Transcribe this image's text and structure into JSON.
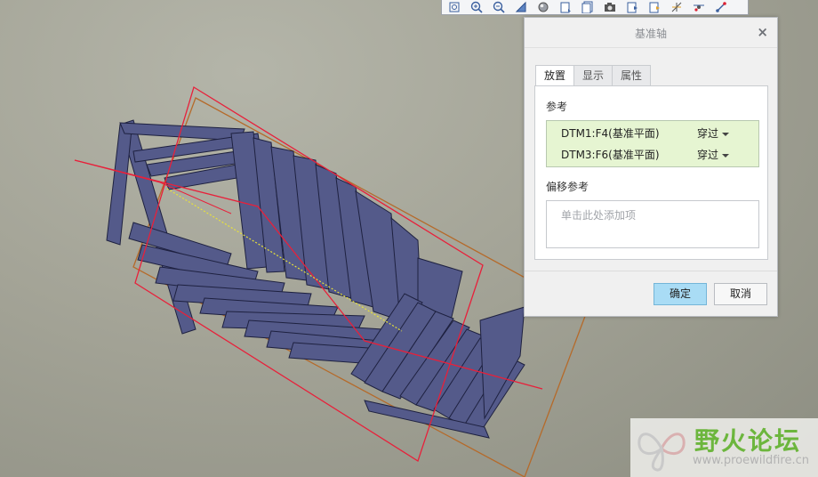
{
  "toolbar": {
    "icons": [
      "refit-icon",
      "zoom-in-icon",
      "zoom-out-icon",
      "repaint-icon",
      "display-style-icon",
      "saved-orientations-icon",
      "named-views-icon",
      "camera-icon",
      "datum-display-icon",
      "annotation-display-icon",
      "spin-center-icon",
      "datum-point-icon",
      "datum-csys-icon"
    ]
  },
  "dialog": {
    "title": "基准轴",
    "close_glyph": "×",
    "tabs": [
      {
        "label": "放置",
        "active": true
      },
      {
        "label": "显示",
        "active": false
      },
      {
        "label": "属性",
        "active": false
      }
    ],
    "references_label": "参考",
    "references": [
      {
        "name": "DTM1:F4(基准平面)",
        "type": "穿过"
      },
      {
        "name": "DTM3:F6(基准平面)",
        "type": "穿过"
      }
    ],
    "offset_label": "偏移参考",
    "offset_placeholder": "单击此处添加项",
    "ok_label": "确定",
    "cancel_label": "取消"
  },
  "watermark": {
    "title": "野火论坛",
    "url": "www.proewildfire.cn"
  },
  "colors": {
    "model_fill": "#545a8a",
    "model_edge": "#1e2140",
    "datum_plane_red": "#e8203a",
    "datum_plane_brown": "#b56a2a",
    "axis_yellow": "#e8e23a",
    "ok_button": "#a9dcf5",
    "refs_highlight": "#e6f5d2",
    "watermark_green": "#6cb63d"
  }
}
